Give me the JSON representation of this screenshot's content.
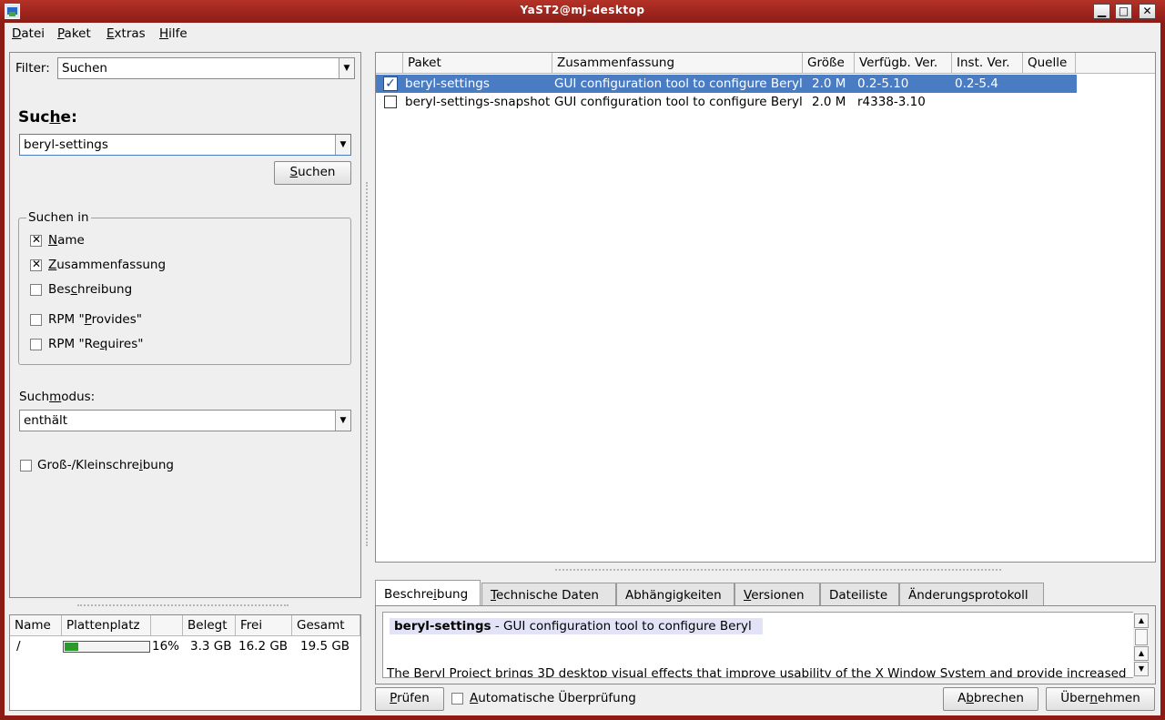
{
  "window": {
    "title": "YaST2@mj-desktop",
    "minimize": "▁",
    "maximize": "□",
    "close": "✕"
  },
  "menu": [
    {
      "label": "Datei",
      "ul": "D",
      "rest": "atei"
    },
    {
      "label": "Paket",
      "ul": "P",
      "rest": "aket"
    },
    {
      "label": "Extras",
      "ul": "E",
      "rest": "xtras"
    },
    {
      "label": "Hilfe",
      "ul": "H",
      "rest": "ilfe"
    }
  ],
  "filter": {
    "label": "Filter:",
    "value": "Suchen"
  },
  "search": {
    "heading_pre": "Suc",
    "heading_ul": "h",
    "heading_post": "e:",
    "input_value": "beryl-settings",
    "button_ul": "S",
    "button_rest": "uchen"
  },
  "search_in": {
    "title": "Suchen in",
    "options": [
      {
        "pre": "",
        "ul": "N",
        "post": "ame",
        "checked": true
      },
      {
        "pre": "",
        "ul": "Z",
        "post": "usammenfassung",
        "checked": true
      },
      {
        "pre": "Bes",
        "ul": "c",
        "post": "hreibung",
        "checked": false
      },
      {
        "pre": "RPM \"",
        "ul": "P",
        "post": "rovides\"",
        "checked": false
      },
      {
        "pre": "RPM \"Re",
        "ul": "q",
        "post": "uires\"",
        "checked": false
      }
    ]
  },
  "search_mode": {
    "label_pre": "Such",
    "label_ul": "m",
    "label_post": "odus:",
    "value": "enthält"
  },
  "case_sensitive": {
    "pre": "Groß-/Kleinschre",
    "ul": "i",
    "post": "bung",
    "checked": false
  },
  "disk": {
    "headers": [
      "Name",
      "Plattenplatz",
      "",
      "Belegt",
      "Frei",
      "Gesamt"
    ],
    "rows": [
      {
        "name": "/",
        "usage_fraction": 0.16,
        "percent": "16%",
        "used": "3.3 GB",
        "free": "16.2 GB",
        "total": "19.5 GB"
      }
    ]
  },
  "packages": {
    "headers": [
      "",
      "Paket",
      "Zusammenfassung",
      "Größe",
      "Verfügb. Ver.",
      "Inst. Ver.",
      "Quelle"
    ],
    "rows": [
      {
        "name": "beryl-settings",
        "summary": "GUI configuration tool to configure Beryl",
        "size": "2.0 M",
        "available": "0.2-5.10",
        "installed": "0.2-5.4",
        "source": "",
        "checked": true,
        "selected": true
      },
      {
        "name": "beryl-settings-snapshot",
        "summary": "GUI configuration tool to configure Beryl",
        "size": "2.0 M",
        "available": "r4338-3.10",
        "installed": "",
        "source": "",
        "checked": false,
        "selected": false
      }
    ]
  },
  "tabs": [
    {
      "pre": "Beschre",
      "ul": "i",
      "post": "bung",
      "active": true
    },
    {
      "pre": "",
      "ul": "T",
      "post": "echnische Daten",
      "active": false
    },
    {
      "pre": "Abhängigkeiten",
      "ul": "",
      "post": "",
      "active": false
    },
    {
      "pre": "",
      "ul": "V",
      "post": "ersionen",
      "active": false
    },
    {
      "pre": "Dateiliste",
      "ul": "",
      "post": "",
      "active": false
    },
    {
      "pre": "Änderungsprotokoll",
      "ul": "",
      "post": "",
      "active": false
    }
  ],
  "description": {
    "name": "beryl-settings",
    "summary": " - GUI configuration tool to configure Beryl",
    "body": "The Beryl Project brings 3D desktop visual effects that improve usability of the X Window System and provide increased"
  },
  "bottom": {
    "check_button_ul": "P",
    "check_button_rest": "rüfen",
    "auto_check_ul": "A",
    "auto_check_rest": "utomatische Überprüfung",
    "cancel_pre": "A",
    "cancel_ul": "b",
    "cancel_post": "brechen",
    "apply_pre": "Über",
    "apply_ul": "n",
    "apply_post": "ehmen"
  },
  "colors": {
    "selection": "#4a7cc4",
    "titlebar": "#b43228",
    "disk_fill": "#2a9a2a"
  }
}
